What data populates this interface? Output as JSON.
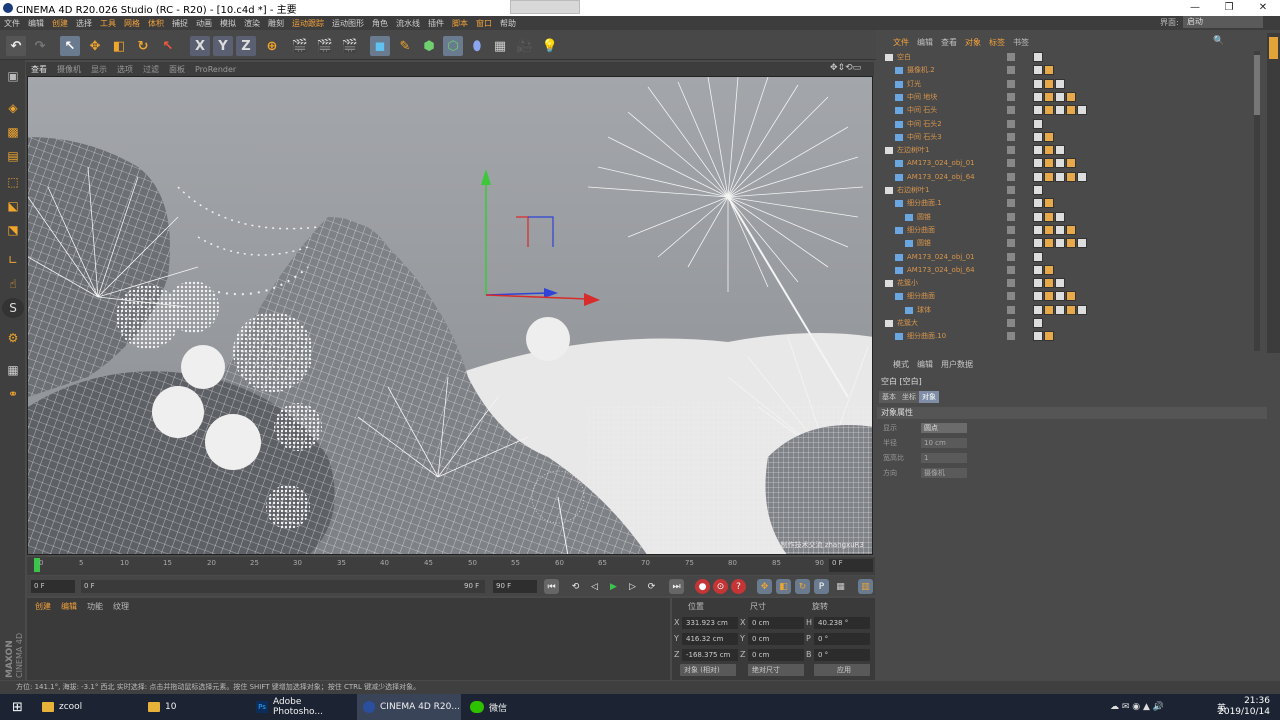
{
  "window": {
    "title": "CINEMA 4D R20.026 Studio (RC - R20) - [10.c4d *] - 主要"
  },
  "menubar": {
    "items": [
      "文件",
      "编辑",
      "创建",
      "选择",
      "工具",
      "网格",
      "体积",
      "捕捉",
      "动画",
      "模拟",
      "渲染",
      "雕刻",
      "运动跟踪",
      "运动图形",
      "角色",
      "流水线",
      "插件",
      "脚本",
      "窗口",
      "帮助"
    ],
    "layout_label": "界面:",
    "layout_value": "启动"
  },
  "viewport": {
    "menu": [
      "查看",
      "摄像机",
      "显示",
      "选项",
      "过滤",
      "面板",
      "ProRender"
    ],
    "watermark": "制作技术交流 zhangxuR3"
  },
  "timeline": {
    "ticks": [
      "0",
      "5",
      "10",
      "15",
      "20",
      "25",
      "30",
      "35",
      "40",
      "45",
      "50",
      "55",
      "60",
      "65",
      "70",
      "75",
      "80",
      "85",
      "90"
    ],
    "frame_end": "0 F"
  },
  "transport": {
    "start_field": "0 F",
    "min_field": "0 F",
    "max_field": "90 F",
    "end_field": "90 F"
  },
  "material": {
    "tabs": [
      "创建",
      "编辑",
      "功能",
      "纹理"
    ]
  },
  "coords": {
    "headers": [
      "位置",
      "尺寸",
      "旋转"
    ],
    "rows": [
      {
        "axis": "X",
        "pos": "331.923 cm",
        "size_axis": "X",
        "size": "0 cm",
        "rot_axis": "H",
        "rot": "40.238 °"
      },
      {
        "axis": "Y",
        "pos": "416.32 cm",
        "size_axis": "Y",
        "size": "0 cm",
        "rot_axis": "P",
        "rot": "0 °"
      },
      {
        "axis": "Z",
        "pos": "-168.375 cm",
        "size_axis": "Z",
        "size": "0 cm",
        "rot_axis": "B",
        "rot": "0 °"
      }
    ],
    "mode_object": "对象 (相对)",
    "mode_size": "绝对尺寸",
    "apply": "应用"
  },
  "status": {
    "text": "方位: 141.1°, 海拔: -3.1° 西北    实时选择: 点击并拖动鼠标选择元素。按住 SHIFT 键增加选择对象；按住 CTRL 键减少选择对象。"
  },
  "objmgr": {
    "menu": [
      "文件",
      "编辑",
      "查看",
      "对象",
      "标签",
      "书签"
    ],
    "objects": [
      {
        "indent": 0,
        "name": "空白"
      },
      {
        "indent": 1,
        "name": "摄像机.2"
      },
      {
        "indent": 1,
        "name": "灯光"
      },
      {
        "indent": 1,
        "name": "中间 地块"
      },
      {
        "indent": 1,
        "name": "中间 石头"
      },
      {
        "indent": 1,
        "name": "中间 石头2"
      },
      {
        "indent": 1,
        "name": "中间 石头3"
      },
      {
        "indent": 0,
        "name": "左边树叶1"
      },
      {
        "indent": 1,
        "name": "AM173_024_obj_01"
      },
      {
        "indent": 1,
        "name": "AM173_024_obj_64"
      },
      {
        "indent": 0,
        "name": "右边树叶1"
      },
      {
        "indent": 1,
        "name": "细分曲面.1"
      },
      {
        "indent": 2,
        "name": "圆锥"
      },
      {
        "indent": 1,
        "name": "细分曲面"
      },
      {
        "indent": 2,
        "name": "圆锥"
      },
      {
        "indent": 1,
        "name": "AM173_024_obj_01"
      },
      {
        "indent": 1,
        "name": "AM173_024_obj_64"
      },
      {
        "indent": 0,
        "name": "花簇小"
      },
      {
        "indent": 1,
        "name": "细分曲面"
      },
      {
        "indent": 2,
        "name": "球体"
      },
      {
        "indent": 0,
        "name": "花簇大"
      },
      {
        "indent": 1,
        "name": "细分曲面.10"
      }
    ]
  },
  "attr": {
    "menu": [
      "模式",
      "编辑",
      "用户数据"
    ],
    "title": "空白 [空白]",
    "tabs": [
      "基本",
      "坐标",
      "对象"
    ],
    "section": "对象属性",
    "rows": [
      {
        "label": "显示",
        "value": "圆点"
      },
      {
        "label": "半径",
        "value": "10 cm"
      },
      {
        "label": "宽高比",
        "value": "1"
      },
      {
        "label": "方向",
        "value": "摄像机"
      }
    ]
  },
  "taskbar": {
    "items": [
      "zcool",
      "10",
      "Adobe Photosho...",
      "CINEMA 4D R20...",
      "微信"
    ],
    "ime": "英",
    "time": "21:36",
    "date": "2019/10/14"
  }
}
